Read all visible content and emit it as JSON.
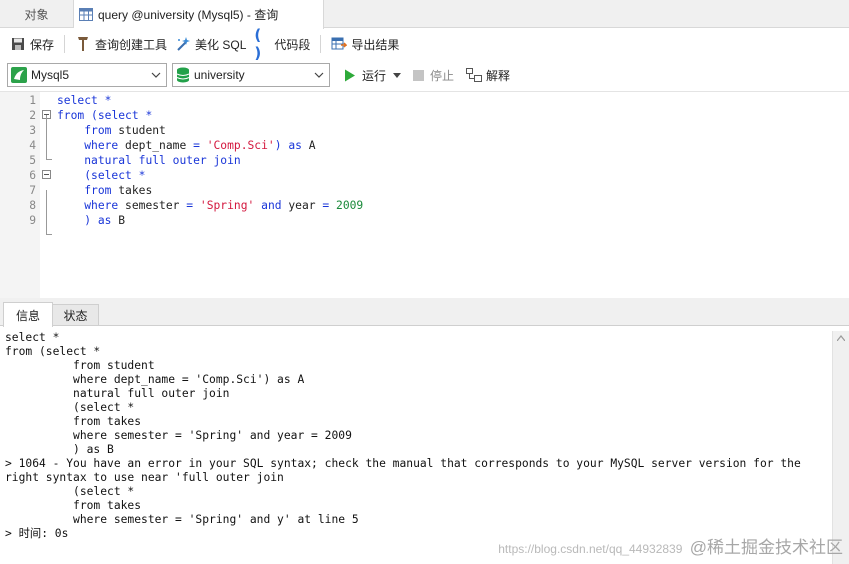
{
  "tabs": {
    "objects": "对象",
    "query": "query @university (Mysql5) - 查询"
  },
  "toolbar": {
    "save": "保存",
    "query_builder": "查询创建工具",
    "beautify": "美化 SQL",
    "snippet": "代码段",
    "export": "导出结果"
  },
  "connection": {
    "selected": "Mysql5"
  },
  "database": {
    "selected": "university"
  },
  "actions": {
    "run": "运行",
    "stop": "停止",
    "explain": "解释"
  },
  "editor": {
    "line_numbers": [
      "1",
      "2",
      "3",
      "4",
      "5",
      "6",
      "7",
      "8",
      "9"
    ],
    "lines": [
      "select *",
      "from (select *",
      "    from student",
      "    where dept_name = 'Comp.Sci') as A",
      "    natural full outer join",
      "    (select *",
      "    from takes",
      "    where semester = 'Spring' and year = 2009",
      "    ) as B"
    ]
  },
  "bottom_tabs": {
    "info": "信息",
    "status": "状态"
  },
  "messages": {
    "text": "select *\nfrom (select *\n          from student\n          where dept_name = 'Comp.Sci') as A\n          natural full outer join\n          (select *\n          from takes\n          where semester = 'Spring' and year = 2009\n          ) as B\n> 1064 - You have an error in your SQL syntax; check the manual that corresponds to your MySQL server version for the\nright syntax to use near 'full outer join\n          (select *\n          from takes\n          where semester = 'Spring' and y' at line 5\n> 时间: 0s"
  },
  "watermark": {
    "url": "https://blog.csdn.net/qq_44932839",
    "brand": "@稀土掘金技术社区"
  },
  "colors": {
    "keyword": "#1a36d8",
    "string": "#d3173e",
    "number": "#1a8a3a",
    "run_green": "#2eaa3a"
  }
}
